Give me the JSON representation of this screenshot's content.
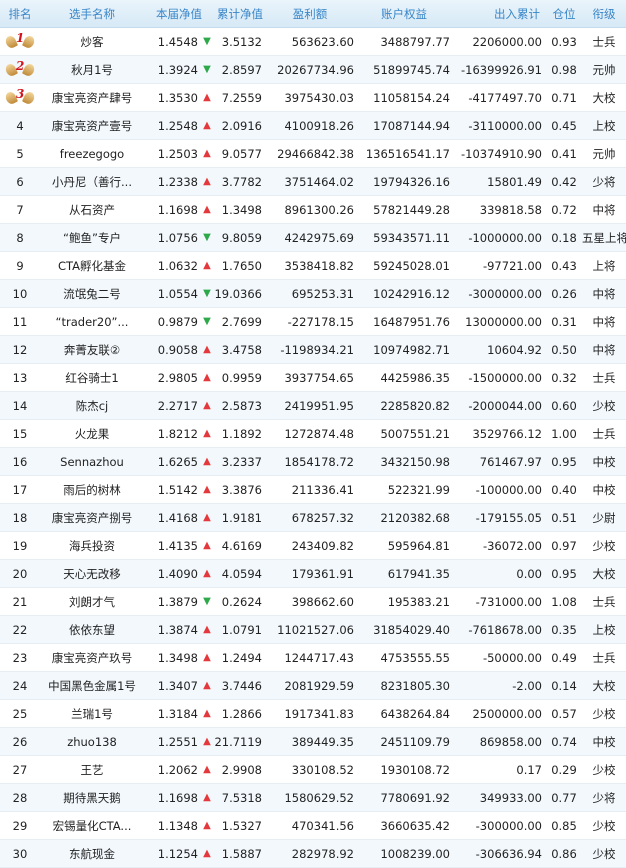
{
  "headers": {
    "rank": "排名",
    "name": "选手名称",
    "nav": "本届净值",
    "cum_nav": "累计净值",
    "pnl": "盈利额",
    "equity": "账户权益",
    "flow": "出入累计",
    "position": "仓位",
    "title": "衔级"
  },
  "colors": {
    "header_text": "#3a86c8",
    "up": "#e4393c",
    "down": "#2ea94a"
  },
  "rows": [
    {
      "rank": "1",
      "medal": true,
      "name": "炒客",
      "nav": "1.4548",
      "dir": "down",
      "cum": "3.5132",
      "pnl": "563623.60",
      "equity": "3488797.77",
      "flow": "2206000.00",
      "pos": "0.93",
      "title": "士兵"
    },
    {
      "rank": "2",
      "medal": true,
      "name": "秋月1号",
      "nav": "1.3924",
      "dir": "down",
      "cum": "2.8597",
      "pnl": "20267734.96",
      "equity": "51899745.74",
      "flow": "-16399926.91",
      "pos": "0.98",
      "title": "元帅"
    },
    {
      "rank": "3",
      "medal": true,
      "name": "康宝亮资产肆号",
      "nav": "1.3530",
      "dir": "up",
      "cum": "7.2559",
      "pnl": "3975430.03",
      "equity": "11058154.24",
      "flow": "-4177497.70",
      "pos": "0.71",
      "title": "大校"
    },
    {
      "rank": "4",
      "name": "康宝亮资产壹号",
      "nav": "1.2548",
      "dir": "up",
      "cum": "2.0916",
      "pnl": "4100918.26",
      "equity": "17087144.94",
      "flow": "-3110000.00",
      "pos": "0.45",
      "title": "上校"
    },
    {
      "rank": "5",
      "name": "freezegogo",
      "nav": "1.2503",
      "dir": "up",
      "cum": "9.0577",
      "pnl": "29466842.38",
      "equity": "136516541.17",
      "flow": "-10374910.90",
      "pos": "0.41",
      "title": "元帅"
    },
    {
      "rank": "6",
      "name": "小丹尼（善行...",
      "nav": "1.2338",
      "dir": "up",
      "cum": "3.7782",
      "pnl": "3751464.02",
      "equity": "19794326.16",
      "flow": "15801.49",
      "pos": "0.42",
      "title": "少将"
    },
    {
      "rank": "7",
      "name": "从石资产",
      "nav": "1.1698",
      "dir": "up",
      "cum": "1.3498",
      "pnl": "8961300.26",
      "equity": "57821449.28",
      "flow": "339818.58",
      "pos": "0.72",
      "title": "中将"
    },
    {
      "rank": "8",
      "name": "“鲍鱼”专户",
      "nav": "1.0756",
      "dir": "down",
      "cum": "9.8059",
      "pnl": "4242975.69",
      "equity": "59343571.11",
      "flow": "-1000000.00",
      "pos": "0.18",
      "title": "五星上将"
    },
    {
      "rank": "9",
      "name": "CTA孵化基金",
      "nav": "1.0632",
      "dir": "up",
      "cum": "1.7650",
      "pnl": "3538418.82",
      "equity": "59245028.01",
      "flow": "-97721.00",
      "pos": "0.43",
      "title": "上将"
    },
    {
      "rank": "10",
      "name": "流氓兔二号",
      "nav": "1.0554",
      "dir": "down",
      "cum": "19.0366",
      "pnl": "695253.31",
      "equity": "10242916.12",
      "flow": "-3000000.00",
      "pos": "0.26",
      "title": "中将"
    },
    {
      "rank": "11",
      "name": "“trader20”...",
      "nav": "0.9879",
      "dir": "down",
      "cum": "2.7699",
      "pnl": "-227178.15",
      "equity": "16487951.76",
      "flow": "13000000.00",
      "pos": "0.31",
      "title": "中将"
    },
    {
      "rank": "12",
      "name": "奔菁友联②",
      "nav": "0.9058",
      "dir": "up",
      "cum": "3.4758",
      "pnl": "-1198934.21",
      "equity": "10974982.71",
      "flow": "10604.92",
      "pos": "0.50",
      "title": "中将"
    },
    {
      "rank": "13",
      "name": "红谷骑士1",
      "nav": "2.9805",
      "dir": "up",
      "cum": "0.9959",
      "pnl": "3937754.65",
      "equity": "4425986.35",
      "flow": "-1500000.00",
      "pos": "0.32",
      "title": "士兵"
    },
    {
      "rank": "14",
      "name": "陈杰cj",
      "nav": "2.2717",
      "dir": "up",
      "cum": "2.5873",
      "pnl": "2419951.95",
      "equity": "2285820.82",
      "flow": "-2000044.00",
      "pos": "0.60",
      "title": "少校"
    },
    {
      "rank": "15",
      "name": "火龙果",
      "nav": "1.8212",
      "dir": "up",
      "cum": "1.1892",
      "pnl": "1272874.48",
      "equity": "5007551.21",
      "flow": "3529766.12",
      "pos": "1.00",
      "title": "士兵"
    },
    {
      "rank": "16",
      "name": "Sennazhou",
      "nav": "1.6265",
      "dir": "up",
      "cum": "3.2337",
      "pnl": "1854178.72",
      "equity": "3432150.98",
      "flow": "761467.97",
      "pos": "0.95",
      "title": "中校"
    },
    {
      "rank": "17",
      "name": "雨后的树林",
      "nav": "1.5142",
      "dir": "up",
      "cum": "3.3876",
      "pnl": "211336.41",
      "equity": "522321.99",
      "flow": "-100000.00",
      "pos": "0.40",
      "title": "中校"
    },
    {
      "rank": "18",
      "name": "康宝亮资产捌号",
      "nav": "1.4168",
      "dir": "up",
      "cum": "1.9181",
      "pnl": "678257.32",
      "equity": "2120382.68",
      "flow": "-179155.05",
      "pos": "0.51",
      "title": "少尉"
    },
    {
      "rank": "19",
      "name": "海兵投资",
      "nav": "1.4135",
      "dir": "up",
      "cum": "4.6169",
      "pnl": "243409.82",
      "equity": "595964.81",
      "flow": "-36072.00",
      "pos": "0.97",
      "title": "少校"
    },
    {
      "rank": "20",
      "name": "天心无改移",
      "nav": "1.4090",
      "dir": "up",
      "cum": "4.0594",
      "pnl": "179361.91",
      "equity": "617941.35",
      "flow": "0.00",
      "pos": "0.95",
      "title": "大校"
    },
    {
      "rank": "21",
      "name": "刘朗才气",
      "nav": "1.3879",
      "dir": "down",
      "cum": "0.2624",
      "pnl": "398662.60",
      "equity": "195383.21",
      "flow": "-731000.00",
      "pos": "1.08",
      "title": "士兵"
    },
    {
      "rank": "22",
      "name": "依依东望",
      "nav": "1.3874",
      "dir": "up",
      "cum": "1.0791",
      "pnl": "11021527.06",
      "equity": "31854029.40",
      "flow": "-7618678.00",
      "pos": "0.35",
      "title": "上校"
    },
    {
      "rank": "23",
      "name": "康宝亮资产玖号",
      "nav": "1.3498",
      "dir": "up",
      "cum": "1.2494",
      "pnl": "1244717.43",
      "equity": "4753555.55",
      "flow": "-50000.00",
      "pos": "0.49",
      "title": "士兵"
    },
    {
      "rank": "24",
      "name": "中国黑色金属1号",
      "nav": "1.3407",
      "dir": "up",
      "cum": "3.7446",
      "pnl": "2081929.59",
      "equity": "8231805.30",
      "flow": "-2.00",
      "pos": "0.14",
      "title": "大校"
    },
    {
      "rank": "25",
      "name": "兰瑞1号",
      "nav": "1.3184",
      "dir": "up",
      "cum": "1.2866",
      "pnl": "1917341.83",
      "equity": "6438264.84",
      "flow": "2500000.00",
      "pos": "0.57",
      "title": "少校"
    },
    {
      "rank": "26",
      "name": "zhuo138",
      "nav": "1.2551",
      "dir": "up",
      "cum": "21.7119",
      "pnl": "389449.35",
      "equity": "2451109.79",
      "flow": "869858.00",
      "pos": "0.74",
      "title": "中校"
    },
    {
      "rank": "27",
      "name": "王艺",
      "nav": "1.2062",
      "dir": "up",
      "cum": "2.9908",
      "pnl": "330108.52",
      "equity": "1930108.72",
      "flow": "0.17",
      "pos": "0.29",
      "title": "少校"
    },
    {
      "rank": "28",
      "name": "期待黑天鹅",
      "nav": "1.1698",
      "dir": "up",
      "cum": "7.5318",
      "pnl": "1580629.52",
      "equity": "7780691.92",
      "flow": "349933.00",
      "pos": "0.77",
      "title": "少将"
    },
    {
      "rank": "29",
      "name": "宏锡量化CTA...",
      "nav": "1.1348",
      "dir": "up",
      "cum": "1.5327",
      "pnl": "470341.56",
      "equity": "3660635.42",
      "flow": "-300000.00",
      "pos": "0.85",
      "title": "少校"
    },
    {
      "rank": "30",
      "name": "东航现金",
      "nav": "1.1254",
      "dir": "up",
      "cum": "1.5887",
      "pnl": "282978.92",
      "equity": "1008239.00",
      "flow": "-306636.94",
      "pos": "0.86",
      "title": "少校"
    }
  ]
}
